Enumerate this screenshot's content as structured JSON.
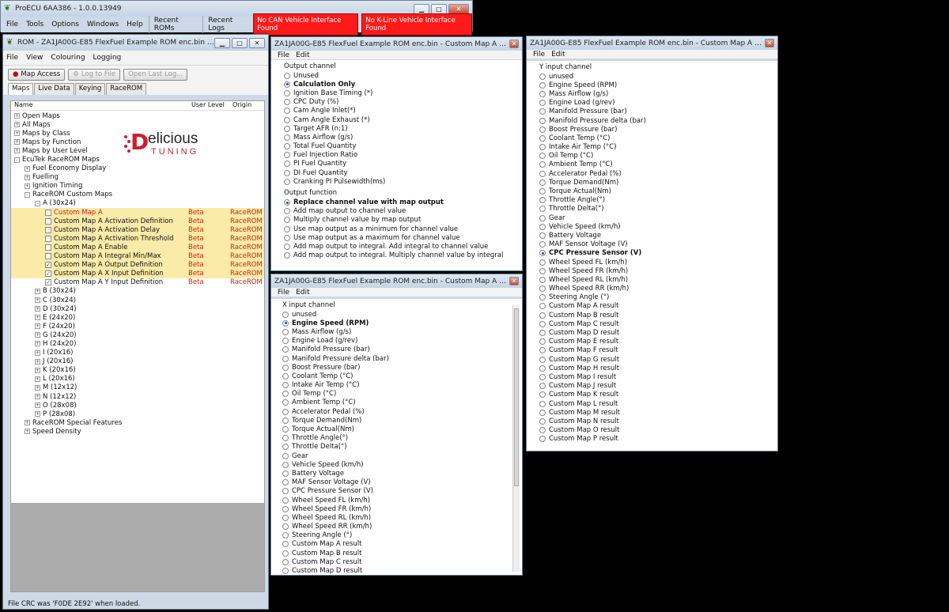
{
  "main": {
    "title": "ProECU 6AA386 - 1.0.0.13949",
    "menu": [
      "File",
      "Tools",
      "Options",
      "Windows",
      "Help",
      "Recent ROMs",
      "Recent Logs"
    ],
    "alerts": [
      "No CAN Vehicle Interface Found",
      "No K-Line Vehicle Interface Found"
    ]
  },
  "rom": {
    "title": "ROM - ZA1JA00G-E85 FlexFuel Example ROM enc.bin (ZA1...",
    "menu": [
      "File",
      "View",
      "Colouring",
      "Logging"
    ],
    "toolbar": {
      "map_access": "Map Access",
      "log_to_file": "Log to File",
      "open_last_log": "Open Last Log..."
    },
    "tabs": [
      "Maps",
      "Live Data",
      "Keying",
      "RaceROM"
    ],
    "columns": {
      "name": "Name",
      "level": "User Level",
      "origin": "Origin"
    },
    "logo": {
      "word": "elicious",
      "letter": "D",
      "sub": "TUNING"
    },
    "tree": [
      {
        "indent": 0,
        "pm": "+",
        "label": "Open Maps"
      },
      {
        "indent": 0,
        "pm": "+",
        "label": "All Maps"
      },
      {
        "indent": 0,
        "pm": "+",
        "label": "Maps by Class"
      },
      {
        "indent": 0,
        "pm": "+",
        "label": "Maps by Function"
      },
      {
        "indent": 0,
        "pm": "+",
        "label": "Maps by User Level"
      },
      {
        "indent": 0,
        "pm": "-",
        "label": "EcuTek RaceROM Maps"
      },
      {
        "indent": 1,
        "pm": "+",
        "label": "Fuel Economy Display"
      },
      {
        "indent": 1,
        "pm": "+",
        "label": "Fuelling"
      },
      {
        "indent": 1,
        "pm": "+",
        "label": "Ignition Timing"
      },
      {
        "indent": 1,
        "pm": "-",
        "label": "RaceROM Custom Maps"
      },
      {
        "indent": 2,
        "pm": "-",
        "label": "A (30x24)"
      },
      {
        "indent": 3,
        "cb": false,
        "label": "Custom Map A",
        "level": "Beta",
        "origin": "RaceROM",
        "hl": true,
        "red": true
      },
      {
        "indent": 3,
        "cb": false,
        "label": "Custom Map A Activation Definition",
        "level": "Beta",
        "origin": "RaceROM",
        "hl": true
      },
      {
        "indent": 3,
        "cb": false,
        "label": "Custom Map A Activation Delay",
        "level": "Beta",
        "origin": "RaceROM",
        "hl": true
      },
      {
        "indent": 3,
        "cb": false,
        "label": "Custom Map A Activation Threshold",
        "level": "Beta",
        "origin": "RaceROM",
        "hl": true
      },
      {
        "indent": 3,
        "cb": false,
        "label": "Custom Map A Enable",
        "level": "Beta",
        "origin": "RaceROM",
        "hl": true
      },
      {
        "indent": 3,
        "cb": false,
        "label": "Custom Map A Integral Min/Max",
        "level": "Beta",
        "origin": "RaceROM",
        "hl": true
      },
      {
        "indent": 3,
        "cb": true,
        "label": "Custom Map A Output Definition",
        "level": "Beta",
        "origin": "RaceROM",
        "hl": true
      },
      {
        "indent": 3,
        "cb": true,
        "label": "Custom Map A X Input Definition",
        "level": "Beta",
        "origin": "RaceROM",
        "hl": true
      },
      {
        "indent": 3,
        "cb": true,
        "label": "Custom Map A Y Input Definition",
        "level": "Beta",
        "origin": "RaceROM",
        "hl": false
      },
      {
        "indent": 2,
        "pm": "+",
        "label": "B (30x24)"
      },
      {
        "indent": 2,
        "pm": "+",
        "label": "C (30x24)"
      },
      {
        "indent": 2,
        "pm": "+",
        "label": "D (30x24)"
      },
      {
        "indent": 2,
        "pm": "+",
        "label": "E (24x20)"
      },
      {
        "indent": 2,
        "pm": "+",
        "label": "F (24x20)"
      },
      {
        "indent": 2,
        "pm": "+",
        "label": "G (24x20)"
      },
      {
        "indent": 2,
        "pm": "+",
        "label": "H (24x20)"
      },
      {
        "indent": 2,
        "pm": "+",
        "label": "I (20x16)"
      },
      {
        "indent": 2,
        "pm": "+",
        "label": "J (20x16)"
      },
      {
        "indent": 2,
        "pm": "+",
        "label": "K (20x16)"
      },
      {
        "indent": 2,
        "pm": "+",
        "label": "L (20x16)"
      },
      {
        "indent": 2,
        "pm": "+",
        "label": "M (12x12)"
      },
      {
        "indent": 2,
        "pm": "+",
        "label": "N (12x12)"
      },
      {
        "indent": 2,
        "pm": "+",
        "label": "O (28x08)"
      },
      {
        "indent": 2,
        "pm": "+",
        "label": "P (28x08)"
      },
      {
        "indent": 1,
        "pm": "+",
        "label": "RaceROM Special Features"
      },
      {
        "indent": 1,
        "pm": "+",
        "label": "Speed Density"
      }
    ],
    "status": "File CRC was 'F0DE 2E92' when loaded."
  },
  "output_def": {
    "title": "ZA1JA00G-E85 FlexFuel Example ROM enc.bin - Custom Map A Output Def...",
    "menu": [
      "File",
      "Edit"
    ],
    "channel_title": "Output channel",
    "channel_selected": 1,
    "channels": [
      "Unused",
      "Calculation Only",
      "Ignition Base Timing (*)",
      "CPC Duty (%)",
      "Cam Angle Inlet(*)",
      "Cam Angle Exhaust (*)",
      "Target AFR (n:1)",
      "Mass Airflow (g/s)",
      "Total Fuel Quantity",
      "Fuel Injection Ratio",
      "PI Fuel Quantity",
      "DI Fuel Quantity",
      "Cranking PI Pulsewidth(ms)"
    ],
    "function_title": "Output function",
    "function_selected": 0,
    "functions": [
      "Replace channel value with map output",
      "Add map output to channel value",
      "Multiply channel value by map output",
      "Use map output as a minimum for channel value",
      "Use map output as a maximum for channel value",
      "Add map output to integral. Add integral to channel value",
      "Add map output to integral. Multiply channel value by integral"
    ]
  },
  "x_input": {
    "title": "ZA1JA00G-E85 FlexFuel Example ROM enc.bin - Custom Map A X Input Def...",
    "menu": [
      "File",
      "Edit"
    ],
    "channel_title": "X input channel",
    "selected": 1,
    "options": [
      "unused",
      "Engine Speed (RPM)",
      "Mass Airflow (g/s)",
      "Engine Load (g/rev)",
      "Manifold Pressure (bar)",
      "Manifold Pressure delta (bar)",
      "Boost Pressure (bar)",
      "Coolant Temp (°C)",
      "Intake Air Temp (°C)",
      "Oil Temp (°C)",
      "Ambient Temp (°C)",
      "Accelerator Pedal (%)",
      "Torque Demand(Nm)",
      "Torque Actual(Nm)",
      "Throttle Angle(°)",
      "Throttle Delta(°)",
      "Gear",
      "Vehicle Speed (km/h)",
      "Battery Voltage",
      "MAF Sensor Voltage (V)",
      "CPC Pressure Sensor (V)",
      "Wheel Speed FL (km/h)",
      "Wheel Speed FR (km/h)",
      "Wheel Speed RL (km/h)",
      "Wheel Speed RR (km/h)",
      "Steering Angle (°)",
      "Custom Map A result",
      "Custom Map B result",
      "Custom Map C result",
      "Custom Map D result"
    ]
  },
  "y_input": {
    "title": "ZA1JA00G-E85 FlexFuel Example ROM enc.bin - Custom Map A Y Input Def...",
    "menu": [
      "File",
      "Edit"
    ],
    "channel_title": "Y input channel",
    "selected": 20,
    "options": [
      "unused",
      "Engine Speed (RPM)",
      "Mass Airflow (g/s)",
      "Engine Load (g/rev)",
      "Manifold Pressure (bar)",
      "Manifold Pressure delta (bar)",
      "Boost Pressure (bar)",
      "Coolant Temp (°C)",
      "Intake Air Temp (°C)",
      "Oil Temp (°C)",
      "Ambient Temp (°C)",
      "Accelerator Pedal (%)",
      "Torque Demand(Nm)",
      "Torque Actual(Nm)",
      "Throttle Angle(°)",
      "Throttle Delta(°)",
      "Gear",
      "Vehicle Speed (km/h)",
      "Battery Voltage",
      "MAF Sensor Voltage (V)",
      "CPC Pressure Sensor (V)",
      "Wheel Speed FL (km/h)",
      "Wheel Speed FR (km/h)",
      "Wheel Speed RL (km/h)",
      "Wheel Speed RR (km/h)",
      "Steering Angle (°)",
      "Custom Map A result",
      "Custom Map B result",
      "Custom Map C result",
      "Custom Map D result",
      "Custom Map E result",
      "Custom Map F result",
      "Custom Map G result",
      "Custom Map H result",
      "Custom Map I result",
      "Custom Map J result",
      "Custom Map K result",
      "Custom Map L result",
      "Custom Map M result",
      "Custom Map N result",
      "Custom Map O result",
      "Custom Map P result"
    ]
  },
  "colors": {
    "alert": "#ff1a1a",
    "highlight": "#fbeba8",
    "red_text": "#d02010",
    "desktop": "#000000"
  }
}
